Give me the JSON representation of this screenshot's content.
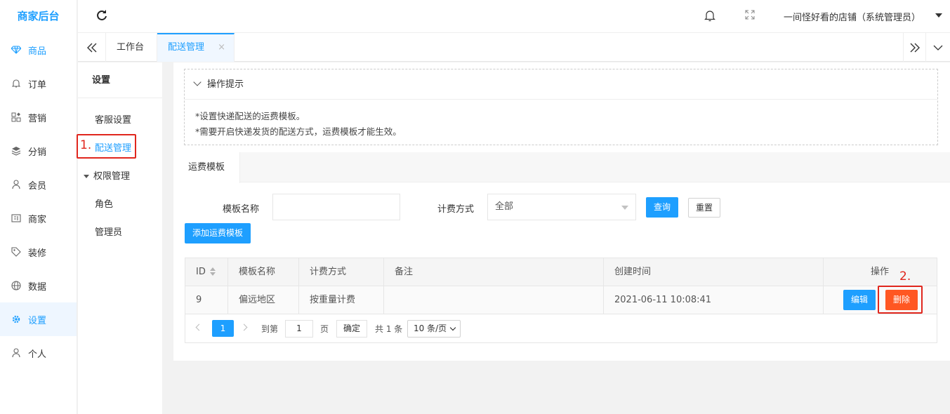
{
  "app": {
    "brand": "商家后台"
  },
  "nav": {
    "items": [
      {
        "label": "商品",
        "icon": "diamond-icon"
      },
      {
        "label": "订单",
        "icon": "bell-icon"
      },
      {
        "label": "营销",
        "icon": "apps-icon"
      },
      {
        "label": "分销",
        "icon": "layers-icon"
      },
      {
        "label": "会员",
        "icon": "user-icon"
      },
      {
        "label": "商家",
        "icon": "shop-icon"
      },
      {
        "label": "装修",
        "icon": "tag-icon"
      },
      {
        "label": "数据",
        "icon": "globe-icon"
      },
      {
        "label": "设置",
        "icon": "gear-icon"
      },
      {
        "label": "个人",
        "icon": "user-icon"
      }
    ],
    "active": "设置"
  },
  "topbar": {
    "user": "一间怪好看的店铺（系统管理员）"
  },
  "tabs": {
    "items": [
      {
        "label": "工作台"
      },
      {
        "label": "配送管理",
        "close": "×"
      }
    ],
    "active": "配送管理"
  },
  "submenu": {
    "title": "设置",
    "items": [
      {
        "label": "客服设置"
      },
      {
        "label": "配送管理"
      },
      {
        "label": "权限管理"
      },
      {
        "label": "角色"
      },
      {
        "label": "管理员"
      }
    ]
  },
  "annotations": {
    "one": "1.",
    "two": "2."
  },
  "tips": {
    "title": "操作提示",
    "lines": [
      "*设置快递配送的运费模板。",
      "*需要开启快递发货的配送方式，运费模板才能生效。"
    ]
  },
  "card": {
    "tab": "运费模板",
    "filter": {
      "name_label": "模板名称",
      "name_value": "",
      "billing_label": "计费方式",
      "billing_value": "全部",
      "query": "查询",
      "reset": "重置"
    },
    "add_button": "添加运费模板"
  },
  "table": {
    "headers": [
      "ID",
      "模板名称",
      "计费方式",
      "备注",
      "创建时间",
      "操作"
    ],
    "rows": [
      {
        "id": "9",
        "name": "偏远地区",
        "billing": "按重量计费",
        "remark": "",
        "created": "2021-06-11 10:08:41",
        "edit": "编辑",
        "delete": "删除"
      }
    ]
  },
  "pagination": {
    "current": "1",
    "goto_label": "到第",
    "goto_value": "1",
    "page_unit": "页",
    "confirm": "确定",
    "total": "共 1 条",
    "page_size": "10 条/页"
  },
  "colors": {
    "primary": "#1e9fff",
    "danger": "#ff5722",
    "annotation": "#e0261d"
  }
}
